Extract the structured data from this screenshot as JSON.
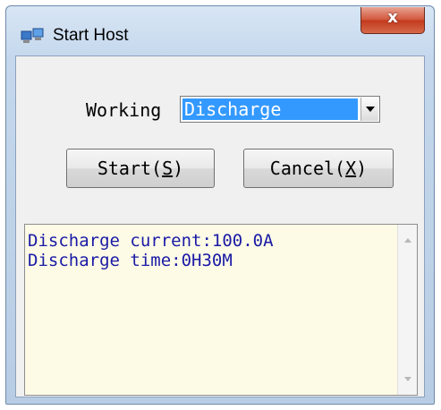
{
  "window": {
    "title": "Start Host",
    "title_icon": "host-app-icon",
    "close_label": "x"
  },
  "form": {
    "working_label": "Working",
    "working_value": "Discharge"
  },
  "buttons": {
    "start_text": "Start(",
    "start_key": "S",
    "start_close": ")",
    "cancel_text": "Cancel(",
    "cancel_key": "X",
    "cancel_close": ")"
  },
  "output": {
    "lines": [
      "Discharge current:100.0A",
      "Discharge time:0H30M"
    ]
  },
  "colors": {
    "selection": "#3399ff",
    "output_text": "#1a1aa6",
    "output_bg": "#fdfbe6",
    "close_button": "#c33a1e"
  }
}
